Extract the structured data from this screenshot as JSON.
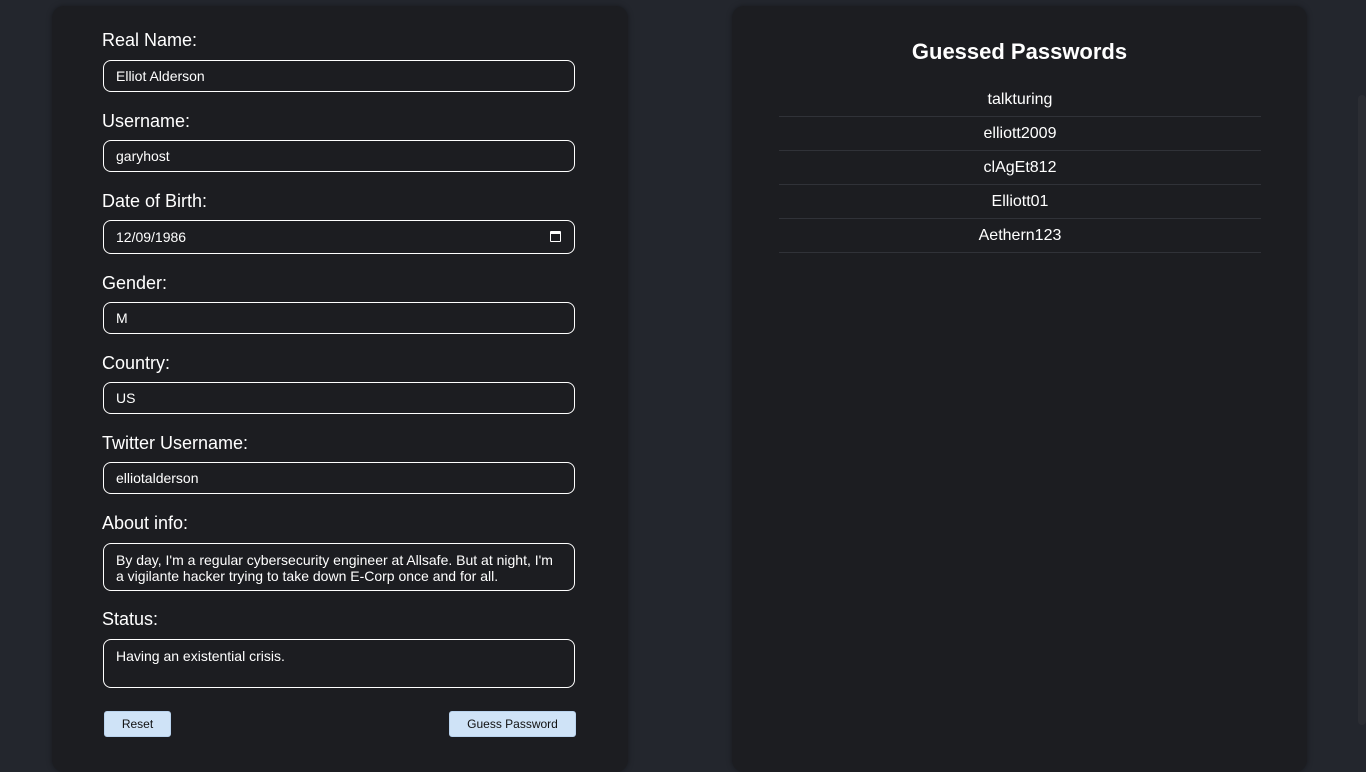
{
  "form": {
    "real_name": {
      "label": "Real Name:",
      "value": "Elliot Alderson"
    },
    "username": {
      "label": "Username:",
      "value": "garyhost"
    },
    "dob": {
      "label": "Date of Birth:",
      "value": "12/09/1986",
      "icon": "calendar-icon"
    },
    "gender": {
      "label": "Gender:",
      "value": "M"
    },
    "country": {
      "label": "Country:",
      "value": "US"
    },
    "twitter": {
      "label": "Twitter Username:",
      "value": "elliotalderson"
    },
    "about": {
      "label": "About info:",
      "value": "By day, I'm a regular cybersecurity engineer at Allsafe. But at night, I'm a vigilante hacker trying to take down E-Corp once and for all."
    },
    "status": {
      "label": "Status:",
      "value": "Having an existential crisis."
    },
    "reset_label": "Reset",
    "guess_label": "Guess Password"
  },
  "results": {
    "title": "Guessed Passwords",
    "passwords": [
      "talkturing",
      "elliott2009",
      "clAgEt812",
      "Elliott01",
      "Aethern123"
    ]
  },
  "colors": {
    "background": "#23262d",
    "panel": "#1c1d21",
    "button": "#cfe3f7",
    "text": "#ffffff"
  }
}
